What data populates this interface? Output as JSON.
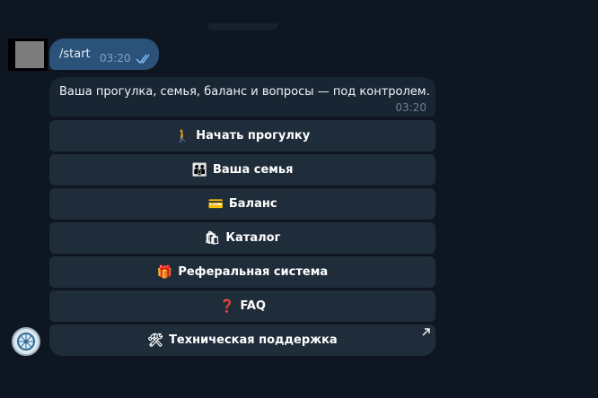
{
  "chat": {
    "outgoing": {
      "text": "/start",
      "time": "03:20"
    },
    "incoming": {
      "text": "Ваша прогулка, семья, баланс и вопросы — под контролем.",
      "time": "03:20"
    }
  },
  "keyboard": {
    "buttons": [
      {
        "icon": "🚶",
        "label": "Начать прогулку"
      },
      {
        "icon": "👪",
        "label": "Ваша семья"
      },
      {
        "icon": "💳",
        "label": "Баланс"
      },
      {
        "icon": "🛍",
        "label": "Каталог"
      },
      {
        "icon": "🎁",
        "label": "Реферальная система"
      },
      {
        "icon": "❓",
        "label": "FAQ"
      },
      {
        "icon": "🛠",
        "label": "Техническая поддержка"
      }
    ]
  },
  "colors": {
    "background": "#0e1621",
    "outgoing_bubble": "#2b5278",
    "incoming_bubble": "#182533",
    "keyboard_button": "#1f2c39"
  }
}
